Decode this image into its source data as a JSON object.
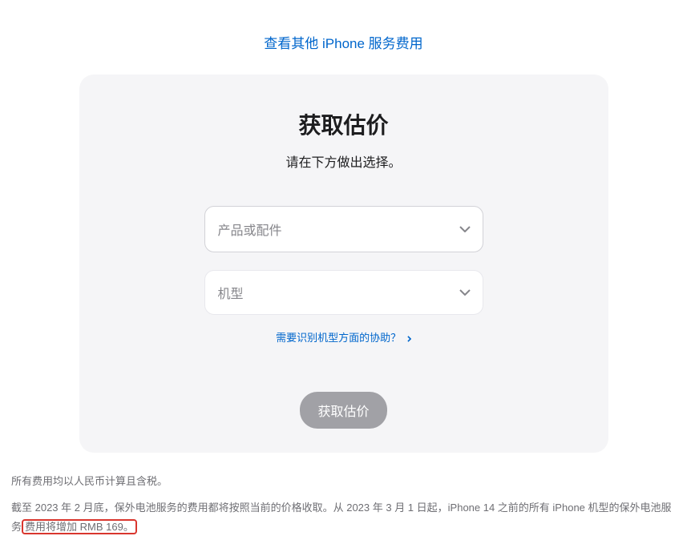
{
  "header": {
    "link_text": "查看其他 iPhone 服务费用"
  },
  "card": {
    "title": "获取估价",
    "subtitle": "请在下方做出选择。",
    "select_product_placeholder": "产品或配件",
    "select_model_placeholder": "机型",
    "help_link_text": "需要识别机型方面的协助？",
    "submit_button_label": "获取估价"
  },
  "footer": {
    "note1": "所有费用均以人民币计算且含税。",
    "note2_prefix": "截至 2023 年 2 月底，保外电池服务的费用都将按照当前的价格收取。从 2023 年 3 月 1 日起，iPhone 14 之前的所有 iPhone 机型的保外电池服务",
    "note2_highlight": "费用将增加 RMB 169。"
  }
}
